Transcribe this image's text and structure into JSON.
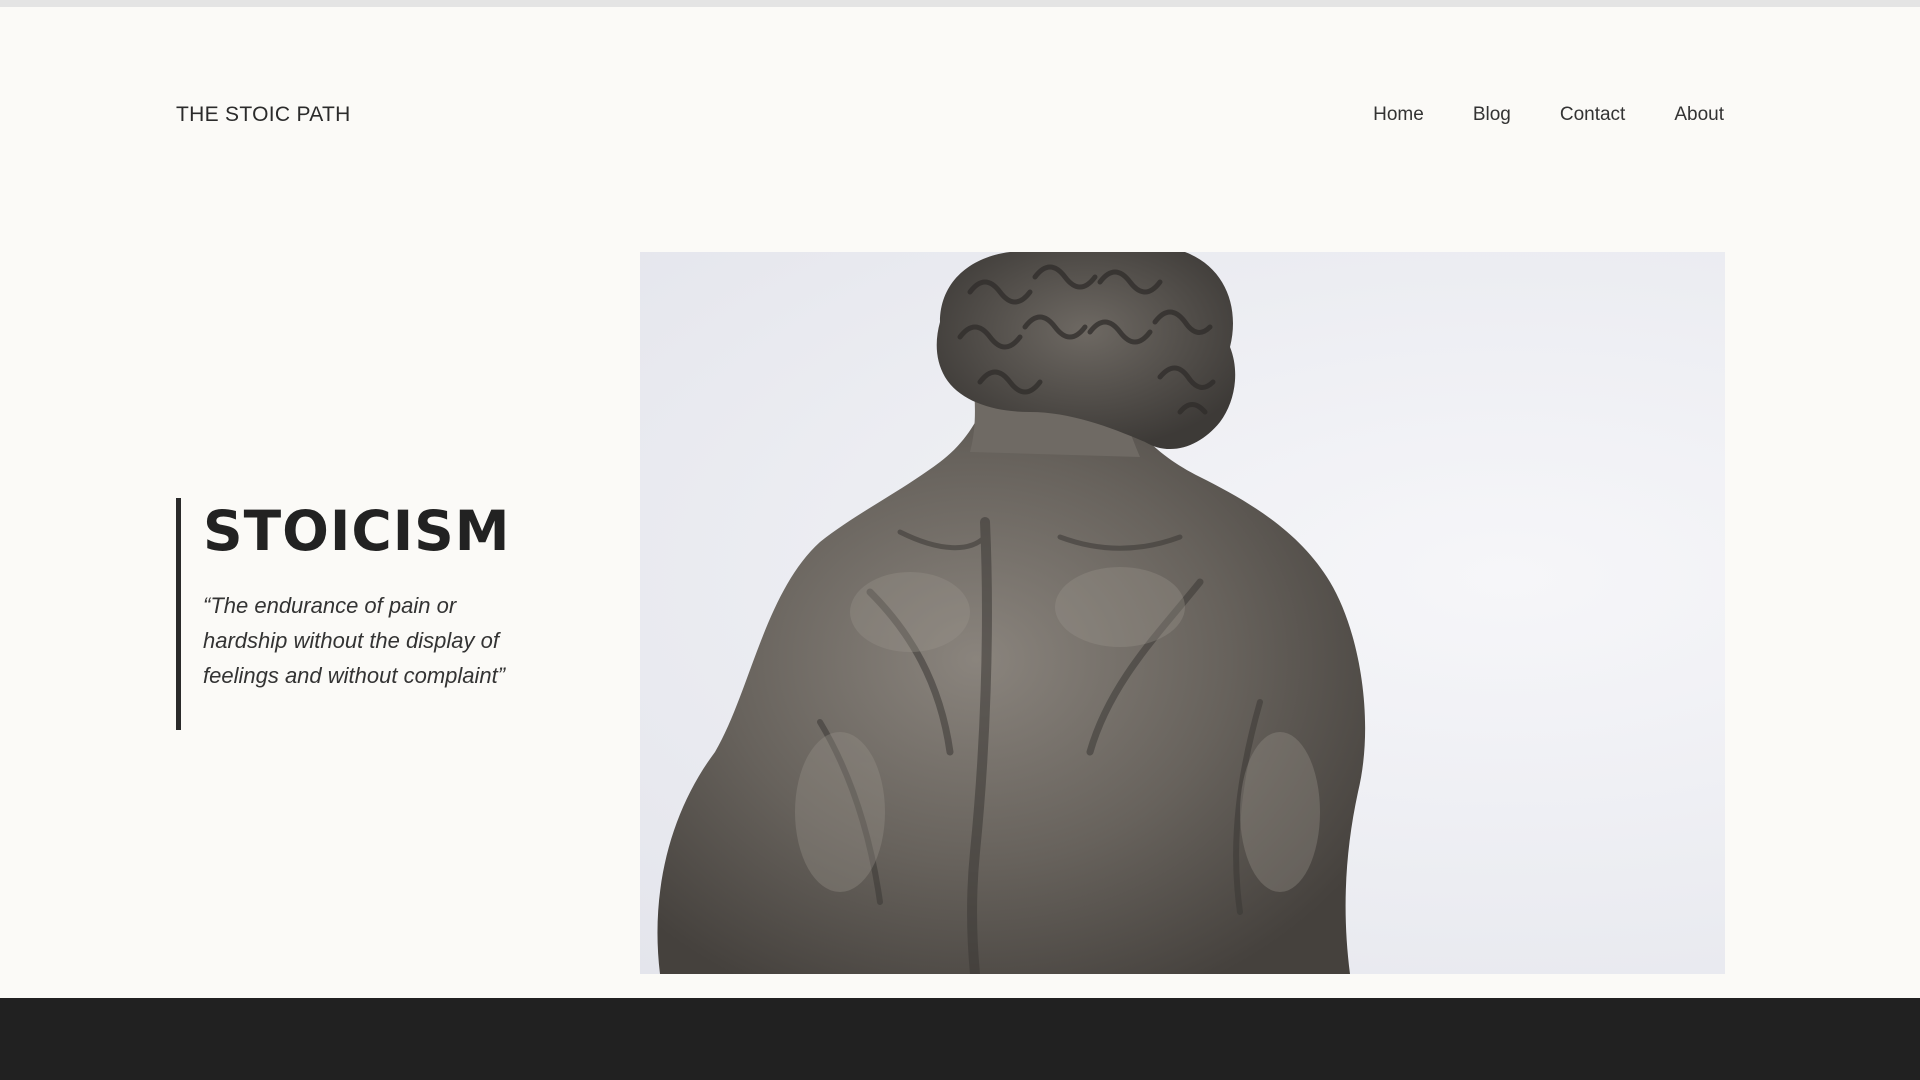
{
  "header": {
    "site_title": "THE STOIC PATH",
    "nav": [
      {
        "label": "Home"
      },
      {
        "label": "Blog"
      },
      {
        "label": "Contact"
      },
      {
        "label": "About"
      }
    ]
  },
  "hero": {
    "heading": "STOICISM",
    "quote": "“The endurance of pain or hardship without the display of feelings and without complaint”",
    "image": {
      "subject": "statue-back-photo"
    }
  },
  "colors": {
    "background": "#fbfaf7",
    "text": "#333333",
    "accent_bar": "#2a2a2a",
    "footer": "#212121"
  }
}
